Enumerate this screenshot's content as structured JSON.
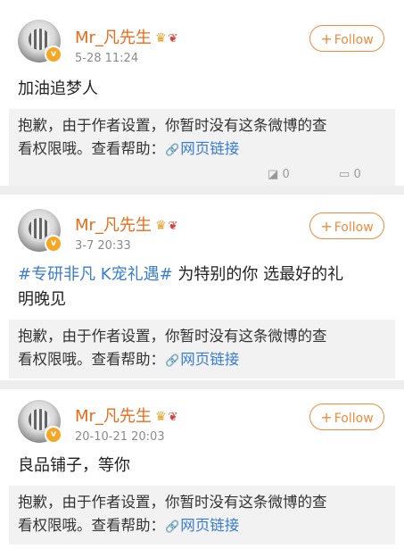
{
  "posts": [
    {
      "author": "Mr_凡先生",
      "date": "5-28 11:24",
      "follow_label": "Follow",
      "text": "加油追梦人",
      "notice_line1": "抱歉，由于作者设置，你暂时没有这条微博的查",
      "notice_line2": "看权限哦。查看帮助：",
      "link_text": "网页链接",
      "actions": {
        "repost": "0",
        "comment": "0"
      }
    },
    {
      "author": "Mr_凡先生",
      "date": "3-7 20:33",
      "follow_label": "Follow",
      "hashtag": "#专研非凡 K宠礼遇#",
      "text_after": " 为特别的你 选最好的礼",
      "text_line2": "明晚见",
      "notice_line1": "抱歉，由于作者设置，你暂时没有这条微博的查",
      "notice_line2": "看权限哦。查看帮助：",
      "link_text": "网页链接"
    },
    {
      "author": "Mr_凡先生",
      "date": "20-10-21 20:03",
      "follow_label": "Follow",
      "text": "良品铺子，等你",
      "notice_line1": "抱歉，由于作者设置，你暂时没有这条微博的查",
      "notice_line2": "看权限哦。查看帮助：",
      "link_text": "网页链接"
    }
  ],
  "colors": {
    "accent": "#f08a3c",
    "name": "#e86b1a",
    "link": "#3a7dd0",
    "notice_bg": "#f2f2f2"
  },
  "icons": [
    "avatar",
    "verified-badge-icon",
    "crown-icon",
    "gift-icon",
    "plus-icon",
    "link-icon",
    "repost-icon",
    "comment-icon"
  ]
}
